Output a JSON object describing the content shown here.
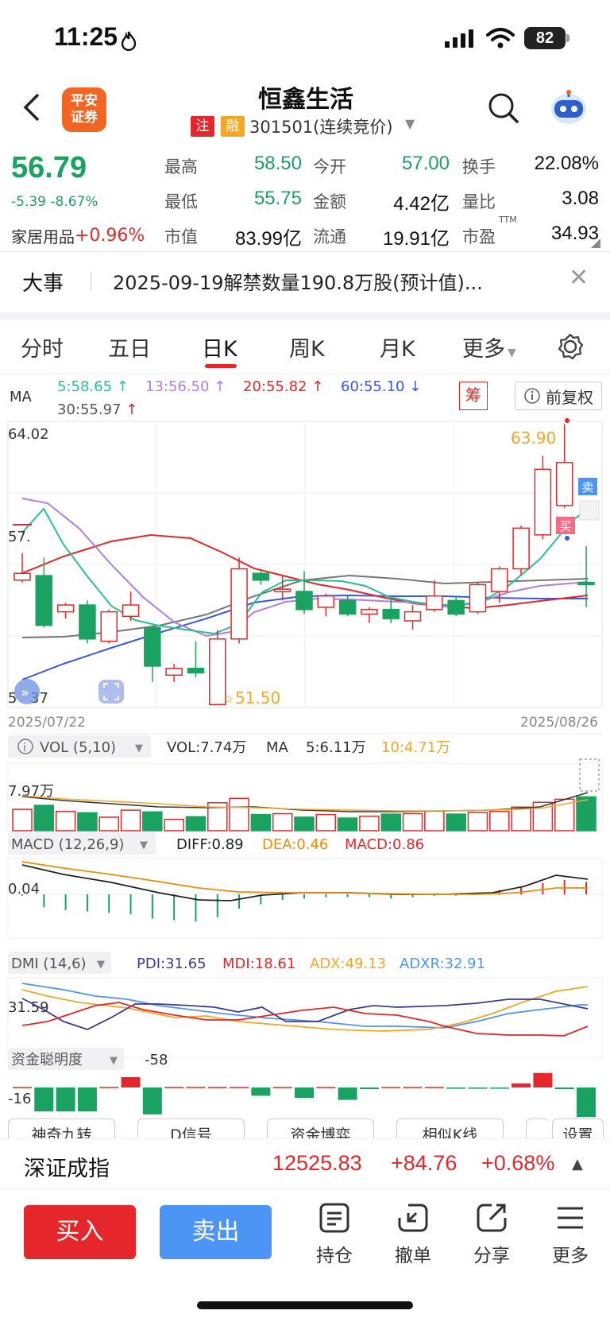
{
  "status_bar": {
    "time": "11:25",
    "battery": "82"
  },
  "header": {
    "broker_logo": "平安\n证券",
    "stock_name": "恒鑫生活",
    "tag_registered": "注",
    "tag_margin": "融",
    "stock_code": "301501(连续竞价)"
  },
  "quote": {
    "price": "56.79",
    "change": "-5.39 -8.67%",
    "sector_name": "家居用品",
    "sector_change": "+0.96%",
    "high_label": "最高",
    "high": "58.50",
    "open_label": "今开",
    "open": "57.00",
    "turnover_label": "换手",
    "turnover": "22.08%",
    "low_label": "最低",
    "low": "55.75",
    "amount_label": "金额",
    "amount": "4.42亿",
    "vol_ratio_label": "量比",
    "vol_ratio": "3.08",
    "mktcap_label": "市值",
    "mktcap": "83.99亿",
    "float_label": "流通",
    "float": "19.91亿",
    "pe_label": "市盈",
    "pe_sup": "TTM",
    "pe": "34.93"
  },
  "event": {
    "label": "大事",
    "text": "2025-09-19解禁数量190.8万股(预计值)..."
  },
  "tabs": [
    "分时",
    "五日",
    "日K",
    "周K",
    "月K",
    "更多"
  ],
  "active_tab": "日K",
  "ma_legend": {
    "label": "MA",
    "ma5": "5:58.65",
    "ma13": "13:56.50",
    "ma20": "20:55.82",
    "ma60": "60:55.10",
    "ma30": "30:55.97",
    "chip": "筹",
    "fuquan": "前复权"
  },
  "colors": {
    "ma5": "#27c28f",
    "ma13": "#b07de3",
    "ma20": "#e5262a",
    "ma60": "#3a57e8",
    "ma30": "#777777",
    "up": "#e5262a",
    "down": "#1aa260",
    "accent": "#e5262a",
    "sell_blue": "#4c95f5"
  },
  "kline": {
    "y_top_label": "64.02",
    "y_mid_label": "57.",
    "y_bottom_label": "5",
    "y_bottom_label2": "37",
    "max_marker": "63.90",
    "min_marker": "51.50",
    "start_date": "2025/07/22",
    "end_date": "2025/08/26",
    "sell_tag": "卖",
    "buy_tag": "买"
  },
  "chart_data": {
    "type": "candlestick",
    "ylim": [
      51.37,
      64.02
    ],
    "candles": [
      {
        "o": 57.0,
        "c": 57.3,
        "h": 58.2,
        "l": 56.9
      },
      {
        "o": 57.2,
        "c": 55.0,
        "h": 58.0,
        "l": 54.9
      },
      {
        "o": 55.6,
        "c": 55.9,
        "h": 56.0,
        "l": 55.3
      },
      {
        "o": 55.9,
        "c": 54.4,
        "h": 56.1,
        "l": 54.2
      },
      {
        "o": 54.3,
        "c": 55.6,
        "h": 55.7,
        "l": 54.2
      },
      {
        "o": 55.4,
        "c": 55.9,
        "h": 56.5,
        "l": 55.2
      },
      {
        "o": 54.9,
        "c": 53.2,
        "h": 55.0,
        "l": 52.5
      },
      {
        "o": 52.8,
        "c": 53.1,
        "h": 53.3,
        "l": 52.5
      },
      {
        "o": 53.1,
        "c": 52.9,
        "h": 54.3,
        "l": 52.7
      },
      {
        "o": 51.5,
        "c": 54.4,
        "h": 54.8,
        "l": 51.5
      },
      {
        "o": 54.4,
        "c": 57.5,
        "h": 58.0,
        "l": 54.2
      },
      {
        "o": 57.3,
        "c": 57.0,
        "h": 57.4,
        "l": 56.8
      },
      {
        "o": 56.5,
        "c": 56.6,
        "h": 57.2,
        "l": 56.1
      },
      {
        "o": 56.5,
        "c": 55.7,
        "h": 57.4,
        "l": 55.5
      },
      {
        "o": 55.8,
        "c": 56.3,
        "h": 56.4,
        "l": 55.4
      },
      {
        "o": 56.1,
        "c": 55.5,
        "h": 56.3,
        "l": 55.4
      },
      {
        "o": 55.5,
        "c": 55.7,
        "h": 55.8,
        "l": 55.1
      },
      {
        "o": 55.7,
        "c": 55.3,
        "h": 56.2,
        "l": 55.1
      },
      {
        "o": 55.2,
        "c": 55.6,
        "h": 55.9,
        "l": 54.8
      },
      {
        "o": 55.7,
        "c": 56.3,
        "h": 57.0,
        "l": 55.6
      },
      {
        "o": 56.1,
        "c": 55.5,
        "h": 56.3,
        "l": 55.4
      },
      {
        "o": 55.6,
        "c": 56.8,
        "h": 56.9,
        "l": 55.5
      },
      {
        "o": 56.5,
        "c": 57.5,
        "h": 57.6,
        "l": 56.0
      },
      {
        "o": 57.5,
        "c": 59.3,
        "h": 59.4,
        "l": 57.2
      },
      {
        "o": 59.0,
        "c": 61.9,
        "h": 62.5,
        "l": 58.8
      },
      {
        "o": 60.3,
        "c": 62.2,
        "h": 63.9,
        "l": 60.2
      },
      {
        "o": 56.9,
        "c": 56.8,
        "h": 58.5,
        "l": 55.8
      }
    ],
    "vol_legend": {
      "label": "VOL (5,10)",
      "vol": "VOL:7.74万",
      "ma": "MA",
      "ma5": "5:6.11万",
      "ma10": "10:4.71万",
      "y_label": "7.97万"
    },
    "volumes": [
      4.9,
      5.8,
      4.4,
      4.1,
      3.1,
      4.7,
      4.3,
      2.6,
      3.2,
      6.4,
      7.4,
      3.7,
      3.9,
      3.1,
      3.7,
      2.9,
      3.3,
      3.8,
      3.9,
      4.5,
      3.8,
      4.2,
      4.4,
      5.4,
      6.5,
      7.2,
      7.74
    ],
    "macd_legend": {
      "label": "MACD (12,26,9)",
      "diff": "DIFF:0.89",
      "dea": "DEA:0.46",
      "macd": "MACD:0.86",
      "y_label": "0.04"
    },
    "macd_hist": [
      -0.1,
      -0.9,
      -1.1,
      -1.2,
      -1.3,
      -1.4,
      -1.7,
      -1.8,
      -1.9,
      -1.6,
      -1.0,
      -0.7,
      -0.4,
      -0.3,
      -0.2,
      -0.2,
      -0.2,
      -0.3,
      -0.2,
      -0.1,
      -0.1,
      0.1,
      0.3,
      0.5,
      0.8,
      1.0,
      0.86
    ],
    "dmi_legend": {
      "label": "DMI (14,6)",
      "pdi": "PDI:31.65",
      "mdi": "MDI:18.61",
      "adx": "ADX:49.13",
      "adxr": "ADXR:32.91",
      "y_label": "31.59"
    },
    "fund_legend": {
      "label": "资金聪明度",
      "value": "-58",
      "y_label": "-16"
    },
    "fund_hist": [
      0,
      -58,
      -58,
      -58,
      0,
      25,
      -65,
      0,
      0,
      0,
      0,
      -20,
      0,
      -25,
      0,
      -30,
      -4,
      0,
      0,
      0,
      -3,
      -3,
      -3,
      10,
      35,
      -4,
      -80
    ]
  },
  "tool_buttons": [
    "神奇九转",
    "D信号",
    "资金博弈",
    "相似K线",
    "",
    "设置"
  ],
  "index_bar": {
    "name": "深证成指",
    "value": "12525.83",
    "change": "+84.76",
    "pct": "+0.68%"
  },
  "actions": {
    "buy": "买入",
    "sell": "卖出",
    "holdings": "持仓",
    "cancel": "撤单",
    "share": "分享",
    "more": "更多"
  }
}
